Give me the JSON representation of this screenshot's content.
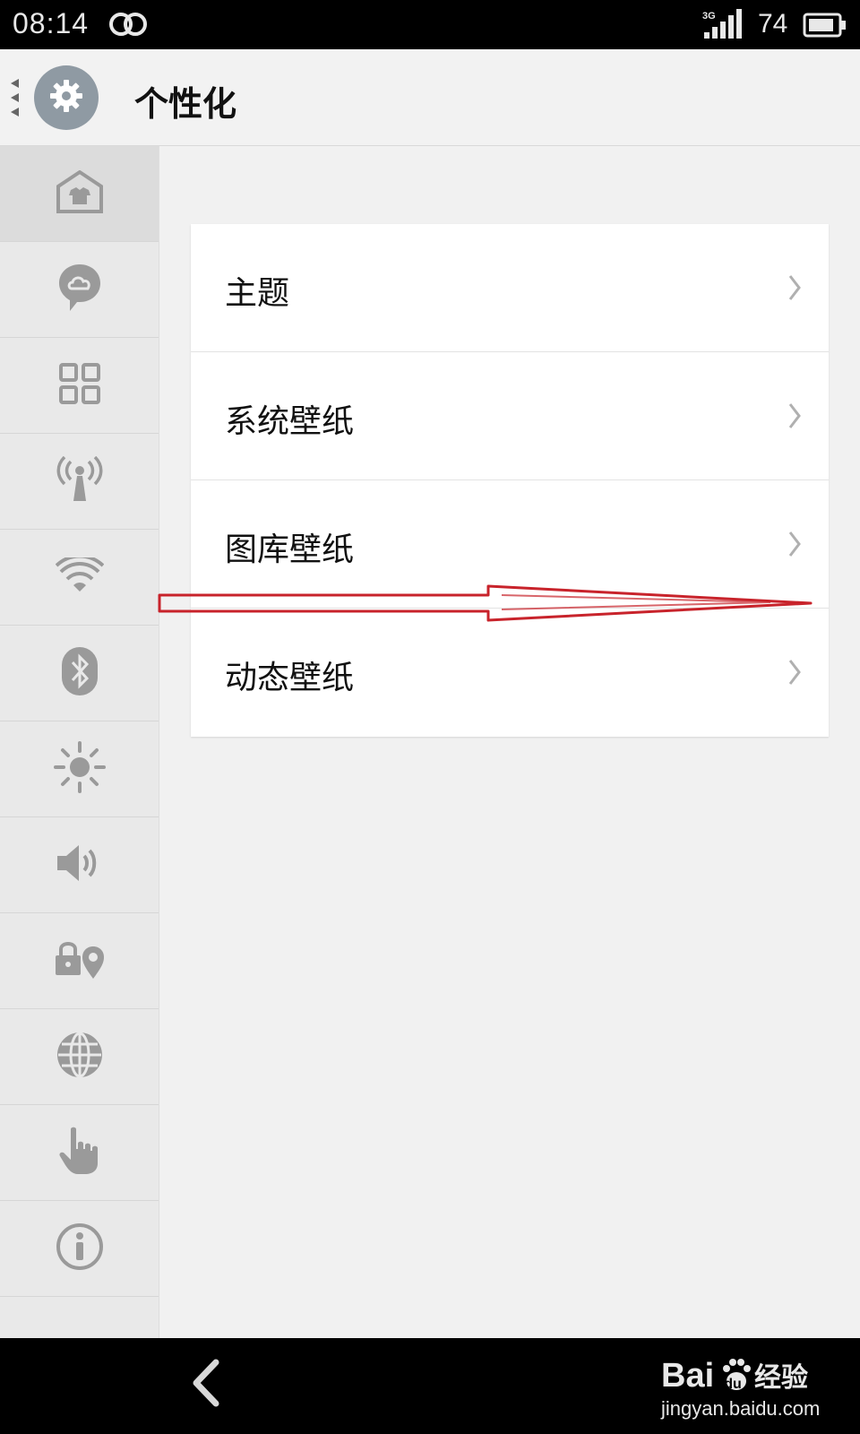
{
  "status_bar": {
    "time": "08:14",
    "network_type": "3G",
    "battery_level": "74"
  },
  "header": {
    "title": "个性化"
  },
  "sidebar": {
    "items": [
      {
        "icon": "theme-icon",
        "active": true
      },
      {
        "icon": "cloud-chat-icon",
        "active": false
      },
      {
        "icon": "apps-grid-icon",
        "active": false
      },
      {
        "icon": "signal-tower-icon",
        "active": false
      },
      {
        "icon": "wifi-icon",
        "active": false
      },
      {
        "icon": "bluetooth-icon",
        "active": false
      },
      {
        "icon": "brightness-icon",
        "active": false
      },
      {
        "icon": "volume-icon",
        "active": false
      },
      {
        "icon": "lock-location-icon",
        "active": false
      },
      {
        "icon": "globe-icon",
        "active": false
      },
      {
        "icon": "hand-pointer-icon",
        "active": false
      },
      {
        "icon": "info-icon",
        "active": false
      }
    ]
  },
  "settings": {
    "rows": [
      {
        "label": "主题"
      },
      {
        "label": "系统壁纸"
      },
      {
        "label": "图库壁纸"
      },
      {
        "label": "动态壁纸"
      }
    ]
  },
  "watermark": {
    "url": "jingyan.baidu.com"
  },
  "colors": {
    "annotation": "#c8232b",
    "icon_gray": "#9a9a9a"
  }
}
